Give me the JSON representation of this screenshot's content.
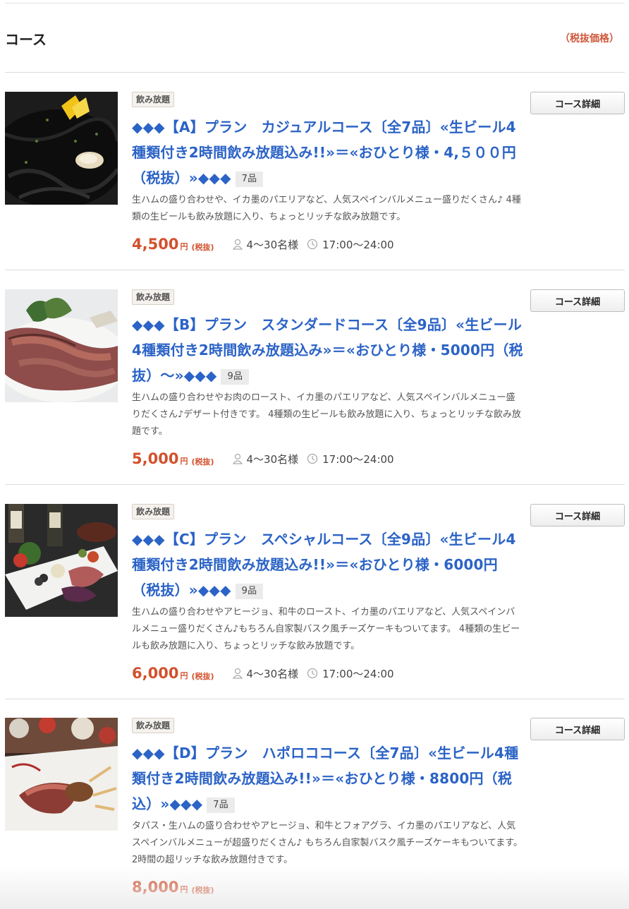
{
  "section": {
    "title": "コース",
    "tax_note": "（税抜価格）"
  },
  "courses": [
    {
      "badge": "飲み放題",
      "title": "◆◆◆【A】プラン　カジュアルコース〔全7品〕«生ビール4種類付き2時間飲み放題込み!!»＝«おひとり様・4,５００円（税抜）»◆◆◆",
      "count": "7品",
      "description": "生ハムの盛り合わせや、イカ墨のパエリアなど、人気スペインバルメニュー盛りだくさん♪ 4種類の生ビールも飲み放題に入り、ちょっとリッチな飲み放題です。",
      "price": "4,500",
      "yen": "円",
      "tax": "(税抜)",
      "people": "4〜30名様",
      "time": "17:00〜24:00",
      "button": "コース詳細"
    },
    {
      "badge": "飲み放題",
      "title": "◆◆◆【B】プラン　スタンダードコース〔全9品〕«生ビール4種類付き2時間飲み放題込み»＝«おひとり様・5000円（税抜）〜»◆◆◆",
      "count": "9品",
      "description": "生ハムの盛り合わせやお肉のロースト、イカ墨のパエリアなど、人気スペインバルメニュー盛りだくさん♪デザート付きです。 4種類の生ビールも飲み放題に入り、ちょっとリッチな飲み放題です。",
      "price": "5,000",
      "yen": "円",
      "tax": "(税抜)",
      "people": "4〜30名様",
      "time": "17:00〜24:00",
      "button": "コース詳細"
    },
    {
      "badge": "飲み放題",
      "title": "◆◆◆【C】プラン　スペシャルコース〔全9品〕«生ビール4種類付き2時間飲み放題込み!!»＝«おひとり様・6000円（税抜）»◆◆◆",
      "count": "9品",
      "description": "生ハムの盛り合わせやアヒージョ、和牛のロースト、イカ墨のパエリアなど、人気スペインバルメニュー盛りだくさん♪もちろん自家製バスク風チーズケーキもついてます。 4種類の生ビールも飲み放題に入り、ちょっとリッチな飲み放題です。",
      "price": "6,000",
      "yen": "円",
      "tax": "(税抜)",
      "people": "4〜30名様",
      "time": "17:00〜24:00",
      "button": "コース詳細"
    },
    {
      "badge": "飲み放題",
      "title": "◆◆◆【D】プラン　ハポロココース〔全7品〕«生ビール4種類付き2時間飲み放題込み!!»＝«おひとり様・8800円（税込）»◆◆◆",
      "count": "7品",
      "description": "タパス・生ハムの盛り合わせやアヒージョ、和牛とフォアグラ、イカ墨のパエリアなど、人気スペインバルメニューが超盛りだくさん♪ もちろん自家製バスク風チーズケーキもついてます。 2時間の超リッチな飲み放題付きです。",
      "price": "8,000",
      "yen": "円",
      "tax": "(税抜)",
      "button": "コース詳細"
    }
  ]
}
